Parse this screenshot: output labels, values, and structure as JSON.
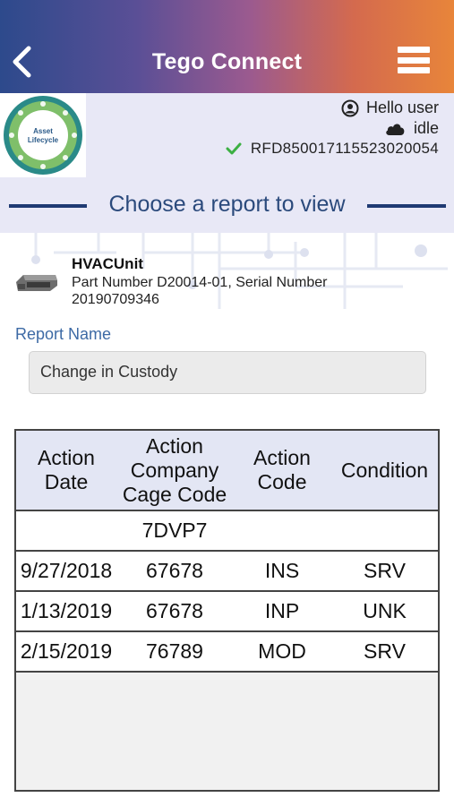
{
  "header": {
    "title": "Tego Connect"
  },
  "logo": {
    "line1": "Asset",
    "line2": "Lifecycle"
  },
  "user": {
    "greeting": "Hello user",
    "status": "idle",
    "rfid": "RFD850017115523020054"
  },
  "section": {
    "title": "Choose a report to view"
  },
  "device": {
    "name": "HVACUnit",
    "description": "Part Number D20014-01, Serial Number 20190709346"
  },
  "report": {
    "label": "Report Name",
    "selected": "Change in Custody"
  },
  "table": {
    "headers": {
      "col1": [
        "Action",
        "Date"
      ],
      "col2": [
        "Action",
        "Company",
        "Cage Code"
      ],
      "col3": [
        "Action",
        "Code"
      ],
      "col4": [
        "Condition"
      ]
    },
    "rows": [
      {
        "date": "",
        "cage": "7DVP7",
        "code": "",
        "condition": ""
      },
      {
        "date": "9/27/2018",
        "cage": "67678",
        "code": "INS",
        "condition": "SRV"
      },
      {
        "date": "1/13/2019",
        "cage": "67678",
        "code": "INP",
        "condition": "UNK"
      },
      {
        "date": "2/15/2019",
        "cage": "76789",
        "code": "MOD",
        "condition": "SRV"
      }
    ]
  },
  "colors": {
    "header_start": "#2d4a8c",
    "header_end": "#e8853a",
    "accent": "#3d6aa5",
    "ok_check": "#3cb043"
  }
}
